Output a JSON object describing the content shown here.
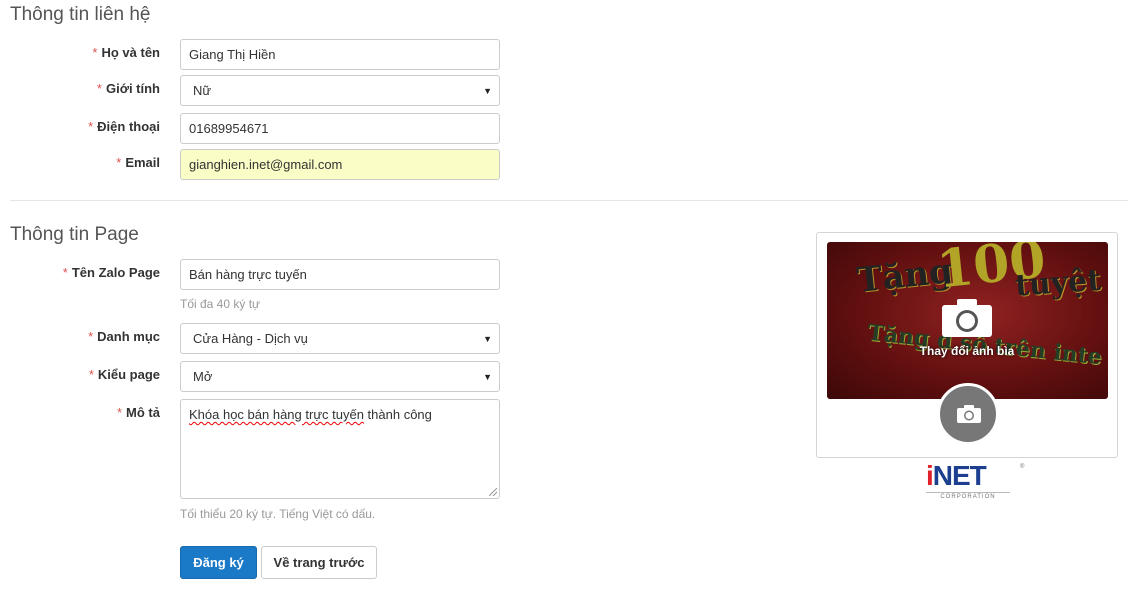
{
  "contact": {
    "title": "Thông tin liên hệ",
    "name": {
      "label": "Họ và tên",
      "value": "Giang Thị Hiền"
    },
    "gender": {
      "label": "Giới tính",
      "value": "Nữ"
    },
    "phone": {
      "label": "Điện thoại",
      "value": "01689954671"
    },
    "email": {
      "label": "Email",
      "value": "gianghien.inet@gmail.com"
    }
  },
  "page": {
    "title": "Thông tin Page",
    "zalo_name": {
      "label": "Tên Zalo Page",
      "value": "Bán hàng trực tuyến",
      "help": "Tối đa 40 ký tự"
    },
    "category": {
      "label": "Danh mục",
      "value": "Cửa Hàng - Dịch vụ"
    },
    "page_type": {
      "label": "Kiểu page",
      "value": "Mở"
    },
    "description": {
      "label": "Mô tả",
      "value_parts": [
        "Khóa học bán hàng trực tuyến",
        " thành công"
      ],
      "help": "Tối thiểu 20 ký tự. Tiếng Việt có dấu."
    }
  },
  "required_marker": "*",
  "buttons": {
    "submit": "Đăng ký",
    "back": "Về trang trước"
  },
  "preview": {
    "change_cover_label": "Thay đổi ảnh bìa",
    "cover_art_text": [
      "Tặng",
      "100",
      "tuyệt ch",
      "Tặng đ",
      "số trên inte"
    ],
    "icons": [
      "camera-icon",
      "camera-icon"
    ]
  },
  "logo": {
    "brand_i": "i",
    "brand_net": "NET",
    "sub": "CORPORATION",
    "reg": "®"
  },
  "colors": {
    "primary": "#1a7ac7",
    "required": "#d9534f",
    "autofill": "#fbfdc6"
  }
}
